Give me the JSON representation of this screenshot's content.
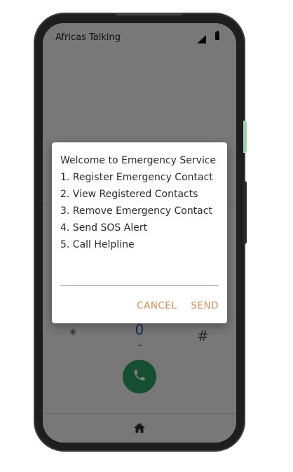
{
  "status_bar": {
    "carrier": "Africas Talking",
    "icons": [
      "signal-icon",
      "battery-icon"
    ]
  },
  "dialer": {
    "keys": {
      "star": "*",
      "zero": "0",
      "plus": "+",
      "hash": "#"
    },
    "call_icon": "phone-icon",
    "call_button_color": "#2c9c62",
    "nav_icon": "home-icon"
  },
  "dialog": {
    "lines": [
      "Welcome to Emergency Service",
      "1. Register Emergency Contact",
      "2. View Registered Contacts",
      "3. Remove Emergency Contact",
      "4. Send SOS Alert",
      "5. Call Helpline"
    ],
    "input_value": "",
    "cancel_label": "CANCEL",
    "send_label": "SEND",
    "accent_color": "#dc8a53"
  }
}
